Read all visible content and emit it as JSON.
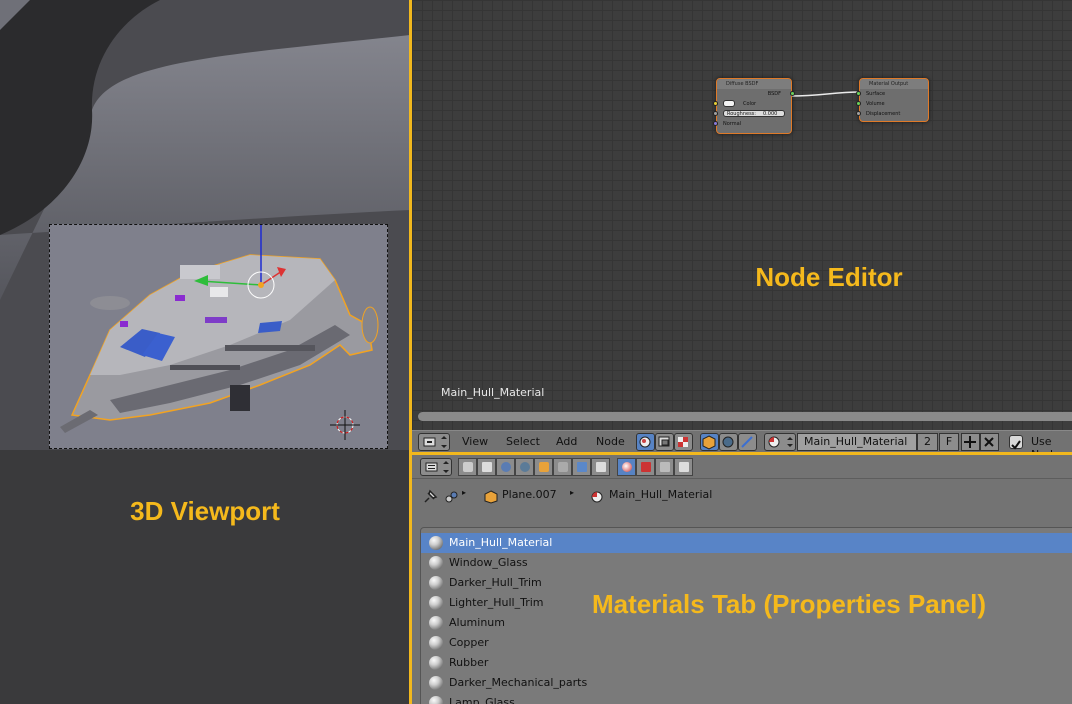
{
  "annotations": {
    "viewport": "3D Viewport",
    "node_editor": "Node Editor",
    "materials": "Materials Tab (Properties  Panel)"
  },
  "colors": {
    "annotation": "#f5b91c",
    "divider": "#f2b81d",
    "selection": "#5884c7",
    "node_border": "#e07a28"
  },
  "node_editor": {
    "material_name_label": "Main_Hull_Material",
    "nodes": {
      "diffuse": {
        "title": "Diffuse BSDF",
        "output": "BSDF",
        "color_label": "Color",
        "roughness_label": "Roughness:",
        "roughness_value": "0.000",
        "normal_label": "Normal"
      },
      "output": {
        "title": "Material Output",
        "surface": "Surface",
        "volume": "Volume",
        "displacement": "Displacement"
      }
    }
  },
  "ne_header": {
    "menus": [
      "View",
      "Select",
      "Add",
      "Node"
    ],
    "material": "Main_Hull_Material",
    "users": "2",
    "fake_user": "F",
    "use_nodes_label": "Use Nod",
    "use_nodes_checked": true
  },
  "properties": {
    "breadcrumb": {
      "object": "Plane.007",
      "material": "Main_Hull_Material"
    },
    "materials": [
      "Main_Hull_Material",
      "Window_Glass",
      "Darker_Hull_Trim",
      "Lighter_Hull_Trim",
      "Aluminum",
      "Copper",
      "Rubber",
      "Darker_Mechanical_parts",
      "Lamp_Glass"
    ],
    "selected_index": 0
  }
}
